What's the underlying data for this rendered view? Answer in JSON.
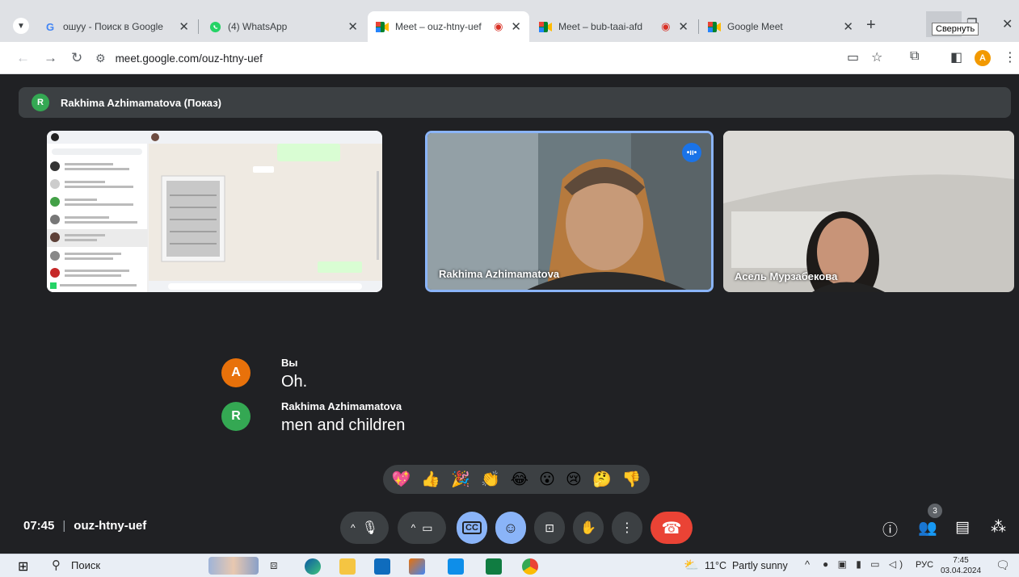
{
  "browser": {
    "tabs": [
      {
        "label": "ошуу - Поиск в Google",
        "icon": "google-icon"
      },
      {
        "label": "(4) WhatsApp",
        "icon": "whatsapp-icon"
      },
      {
        "label": "Meet – ouz-htny-uef",
        "icon": "meet-icon",
        "recording": true,
        "active": true
      },
      {
        "label": "Meet – bub-taai-afd",
        "icon": "meet-icon",
        "recording": true
      },
      {
        "label": "Google Meet",
        "icon": "meet-icon"
      }
    ],
    "tooltip": "Свернуть",
    "url": "meet.google.com/ouz-htny-uef",
    "profile_initial": "A"
  },
  "meet": {
    "presenter_initial": "R",
    "presenter_bar": "Rakhima Azhimamatova (Показ)",
    "participants": [
      {
        "name": "Rakhima Azhimamatova",
        "speaking": true
      },
      {
        "name": "Асель Мурзабекова"
      }
    ],
    "captions": [
      {
        "initial": "A",
        "name": "Вы",
        "text": "Oh.",
        "color": "#e8710a"
      },
      {
        "initial": "R",
        "name": "Rakhima Azhimamatova",
        "text": "men and children",
        "color": "#34a853"
      }
    ],
    "reactions": [
      "💖",
      "👍",
      "🎉",
      "👏",
      "😂",
      "😮",
      "😢",
      "🤔",
      "👎"
    ],
    "time": "07:45",
    "meeting_code": "ouz-htny-uef",
    "people_count": "3",
    "colors": {
      "accent": "#8ab4f8",
      "end_call": "#ea4335",
      "surface": "#3c4043",
      "background": "#202124"
    }
  },
  "taskbar": {
    "search": "Поиск",
    "weather": "11°C  Partly sunny",
    "lang": "РУС",
    "clock_time": "7:45",
    "clock_date": "03.04.2024"
  }
}
